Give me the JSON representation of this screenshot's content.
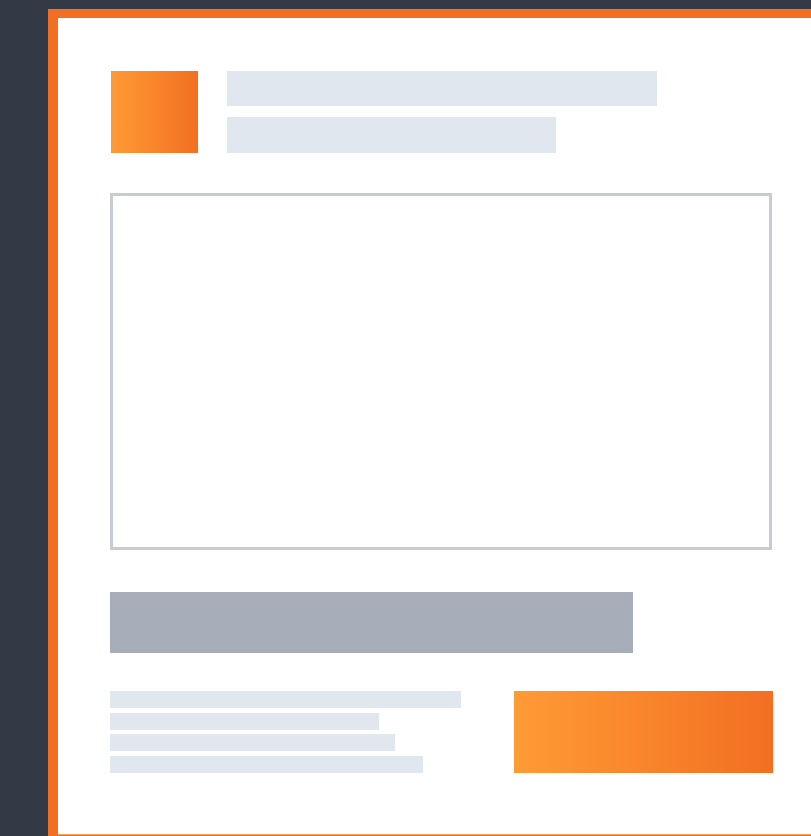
{
  "theme": {
    "background": "#343a45",
    "frame_accent": "#f26f22",
    "card_background": "#ffffff",
    "placeholder_light": "#e0e7ef",
    "placeholder_dark": "#a8adba",
    "panel_border": "#c7ccd3",
    "gradient_start": "#ff9b35",
    "gradient_end": "#f26f22"
  },
  "header": {
    "logo_icon": "logo-icon",
    "title": "",
    "subtitle": ""
  },
  "main": {
    "content_panel_text": "",
    "primary_bar_text": "",
    "detail_lines": [
      "",
      "",
      "",
      ""
    ],
    "action_button_label": ""
  }
}
